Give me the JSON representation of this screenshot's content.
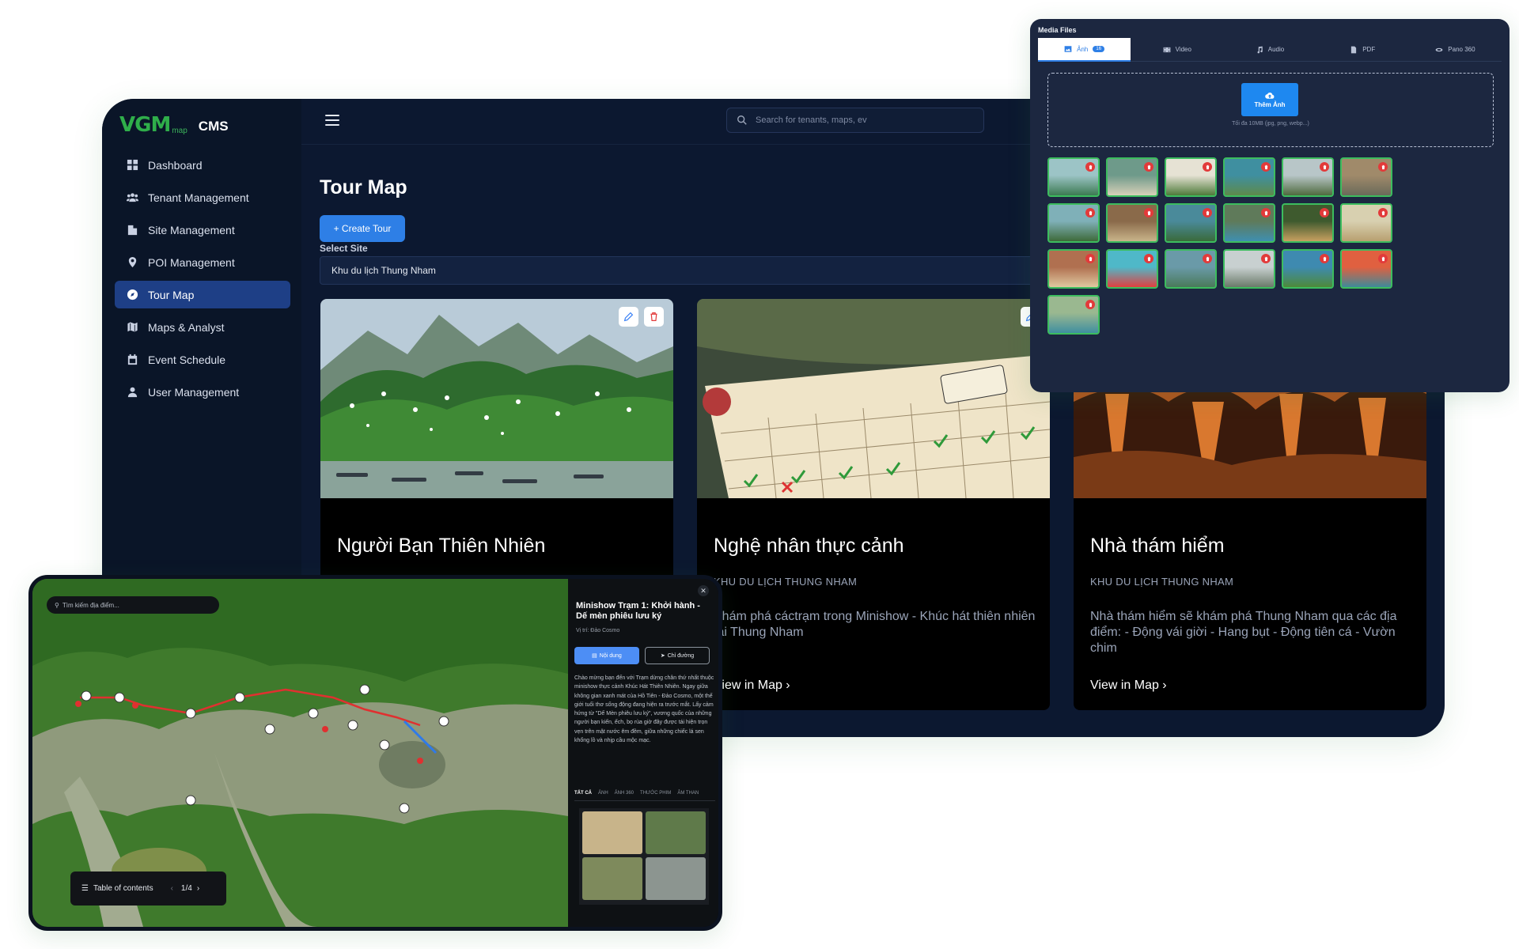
{
  "cms": {
    "logo": {
      "mark": "VGM",
      "sub": "map",
      "product": "CMS"
    },
    "nav": [
      {
        "label": "Dashboard",
        "icon": "grid-icon"
      },
      {
        "label": "Tenant Management",
        "icon": "users-icon"
      },
      {
        "label": "Site Management",
        "icon": "building-icon"
      },
      {
        "label": "POI Management",
        "icon": "pin-icon"
      },
      {
        "label": "Tour Map",
        "icon": "compass-icon",
        "active": true
      },
      {
        "label": "Maps & Analyst",
        "icon": "map-icon"
      },
      {
        "label": "Event Schedule",
        "icon": "calendar-icon"
      },
      {
        "label": "User Management",
        "icon": "user-icon"
      }
    ],
    "search_placeholder": "Search for tenants, maps, ev",
    "page_title": "Tour Map",
    "create_button": "+ Create Tour",
    "select_label": "Select Site",
    "selected_site": "Khu du lịch Thung Nham",
    "cards": [
      {
        "title": "Người Bạn Thiên Nhiên",
        "site": "",
        "description": "",
        "link": ""
      },
      {
        "title": "Nghệ nhân thực cảnh",
        "site": "KHU DU LỊCH THUNG NHAM",
        "description": "Khám phá cáctrạm trong Minishow - Khúc hát thiên nhiên tại Thung Nham",
        "link": "View in Map ›"
      },
      {
        "title": "Nhà thám hiểm",
        "site": "KHU DU LỊCH THUNG NHAM",
        "description": "Nhà thám hiểm sẽ khám phá Thung Nham qua các địa điểm: - Động vái giời - Hang bụt - Động tiên cá - Vườn chim",
        "link": "View in Map ›"
      }
    ]
  },
  "media": {
    "title": "Media Files",
    "tabs": [
      {
        "label": "Ảnh",
        "badge": "16",
        "icon": "image-icon",
        "active": true
      },
      {
        "label": "Video",
        "icon": "film-icon"
      },
      {
        "label": "Audio",
        "icon": "music-icon"
      },
      {
        "label": "PDF",
        "icon": "document-icon"
      },
      {
        "label": "Pano 360",
        "icon": "panorama-icon"
      }
    ],
    "upload_label": "Thêm Ảnh",
    "upload_hint": "Tối đa 10MB (jpg, png, webp...)",
    "thumbnail_count": 19
  },
  "map": {
    "search_placeholder": "Tìm kiếm địa điểm...",
    "toc_label": "Table of contents",
    "toc_page": "1/4",
    "info": {
      "title": "Minishow Trạm 1: Khởi hành - Dế mèn phiêu lưu ký",
      "location": "Vị trí: Đảo Cosmo",
      "content_button": "Nội dung",
      "direction_button": "Chỉ đường",
      "body": "Chào mừng bạn đến với Trạm dừng chân thứ nhất thuộc minishow thực cảnh Khúc Hát Thiên Nhiên. Ngay giữa không gian xanh mát của Hồ Tiên - Đảo Cosmo, một thế giới tuổi thơ sống động đang hiện ra trước mắt. Lấy cảm hứng từ \"Dế Mèn phiêu lưu ký\", vương quốc của những người bạn kiến, ếch, bọ rùa giờ đây được tái hiện trọn vẹn trên mặt nước êm đềm, giữa những chiếc lá sen khổng lồ và nhịp cầu mộc mạc.",
      "tabs": [
        "TẤT CẢ",
        "ẢNH",
        "ẢNH 360",
        "THƯỚC PHIM",
        "ÂM THAN"
      ]
    }
  }
}
